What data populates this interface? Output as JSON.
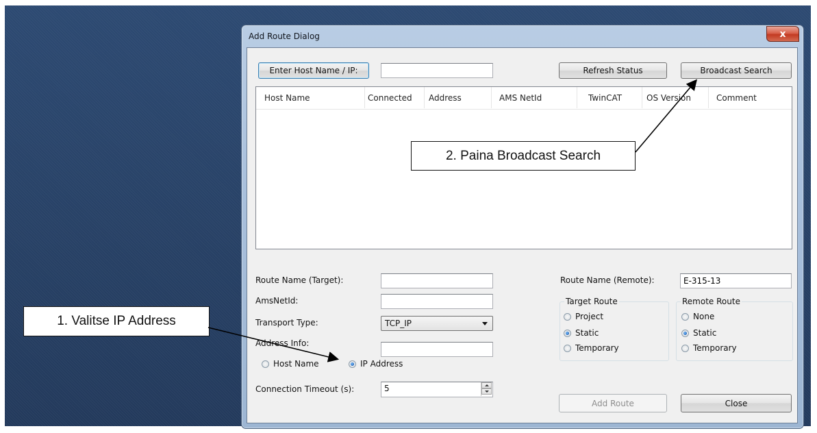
{
  "window": {
    "title": "Add Route Dialog",
    "close_symbol": "x"
  },
  "top_row": {
    "enter_host_button": "Enter Host Name / IP:",
    "host_input_value": "",
    "refresh_status_button": "Refresh Status",
    "broadcast_search_button": "Broadcast Search"
  },
  "host_list": {
    "columns": [
      "Host Name",
      "Connected",
      "Address",
      "AMS NetId",
      "TwinCAT",
      "OS Version",
      "Comment"
    ],
    "rows": []
  },
  "left_form": {
    "route_name_target_label": "Route Name (Target):",
    "route_name_target_value": "",
    "amsnetid_label": "AmsNetId:",
    "amsnetid_value": "",
    "transport_type_label": "Transport Type:",
    "transport_type_value": "TCP_IP",
    "address_info_label": "Address Info:",
    "address_info_value": "",
    "address_mode_options": {
      "host_name": "Host Name",
      "ip_address": "IP Address",
      "selected": "ip_address"
    },
    "connection_timeout_label": "Connection Timeout (s):",
    "connection_timeout_value": "5"
  },
  "right_form": {
    "route_name_remote_label": "Route Name (Remote):",
    "route_name_remote_value": "E-315-13",
    "target_route": {
      "title": "Target Route",
      "options": [
        "Project",
        "Static",
        "Temporary"
      ],
      "selected": "Static"
    },
    "remote_route": {
      "title": "Remote Route",
      "options": [
        "None",
        "Static",
        "Temporary"
      ],
      "selected": "Static"
    }
  },
  "bottom_buttons": {
    "add_route": "Add Route",
    "close": "Close"
  },
  "annotations": {
    "step1": "1. Valitse IP Address",
    "step2": "2. Paina Broadcast Search"
  },
  "colors": {
    "desktop": "#2c4368",
    "window_frame": "#a9c0dc",
    "client": "#f0f0f0",
    "radio_selected": "#1f63b8"
  }
}
